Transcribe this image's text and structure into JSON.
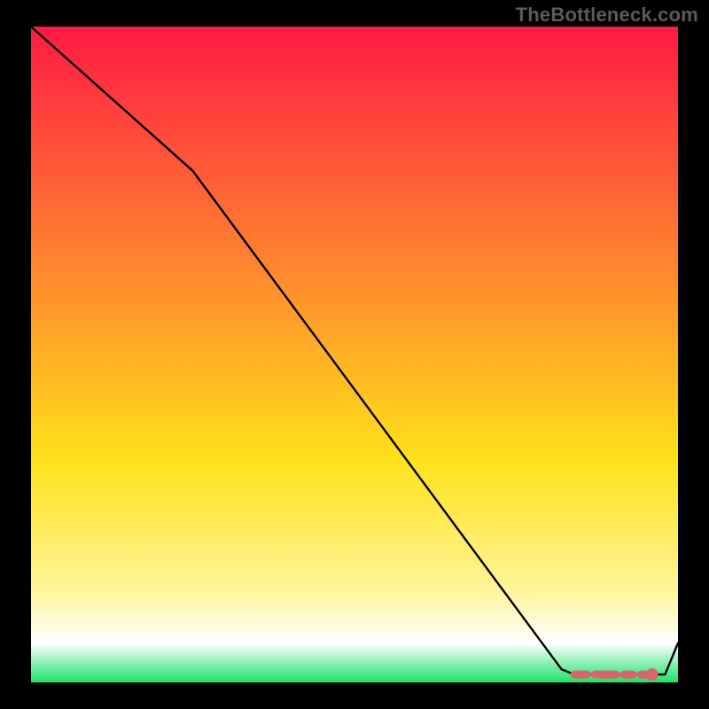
{
  "watermark": "TheBottleneck.com",
  "colors": {
    "background": "#000000",
    "gradient_top": "#ff1a44",
    "gradient_mid_top": "#ff8a2e",
    "gradient_mid": "#ffe11a",
    "gradient_mid_low": "#fff59a",
    "gradient_low": "#ffffff",
    "gradient_bottom": "#1de269",
    "line": "#000000",
    "marker": "#d9656c"
  },
  "chart_data": {
    "type": "line",
    "title": "",
    "xlabel": "",
    "ylabel": "",
    "xlim": [
      0,
      100
    ],
    "ylim": [
      0,
      100
    ],
    "grid": false,
    "legend": false,
    "series": [
      {
        "name": "bottleneck-curve",
        "x": [
          0,
          25,
          82,
          84,
          86,
          88,
          90,
          92,
          94,
          96,
          98,
          100
        ],
        "y": [
          100,
          78,
          2,
          1.2,
          1.2,
          1.2,
          1.2,
          1.2,
          1.2,
          1.2,
          1.2,
          6
        ]
      }
    ],
    "markers": [
      {
        "name": "dash-segment",
        "shape": "dashed-line",
        "x": [
          84,
          96
        ],
        "y": [
          1.2,
          1.2
        ]
      },
      {
        "name": "point-end",
        "shape": "circle",
        "x": 96,
        "y": 1.2
      }
    ]
  }
}
